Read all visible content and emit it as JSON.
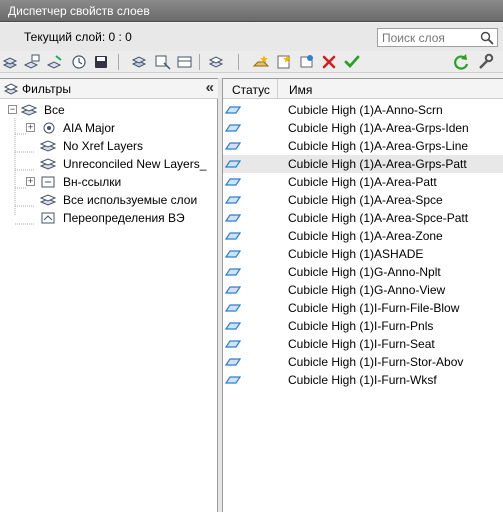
{
  "window": {
    "title": "Диспетчер свойств слоев"
  },
  "current_layer": {
    "label": "Текущий слой: 0 : 0"
  },
  "search": {
    "placeholder": "Поиск слоя"
  },
  "toolbar": {
    "icons": [
      "new-property-filter-icon",
      "new-group-filter-icon",
      "layer-states-manager-icon",
      "save-layer-state-icon",
      "new-layer-icon",
      "new-layer-vp-frozen-icon",
      "delete-layer-icon",
      "set-current-icon",
      "refresh-icon",
      "settings-icon"
    ]
  },
  "filters": {
    "header": "Фильтры",
    "items": [
      {
        "label": "Все"
      },
      {
        "label": "AIA Major"
      },
      {
        "label": "No Xref Layers"
      },
      {
        "label": "Unreconciled New Layers_"
      },
      {
        "label": "Вн-ссылки"
      },
      {
        "label": "Все используемые слои"
      },
      {
        "label": "Переопределения ВЭ"
      }
    ]
  },
  "table": {
    "headers": {
      "status": "Статус",
      "name": "Имя"
    },
    "rows": [
      "Cubicle High (1)A-Anno-Scrn",
      "Cubicle High (1)A-Area-Grps-Iden",
      "Cubicle High (1)A-Area-Grps-Line",
      "Cubicle High (1)A-Area-Grps-Patt",
      "Cubicle High (1)A-Area-Patt",
      "Cubicle High (1)A-Area-Spce",
      "Cubicle High (1)A-Area-Spce-Patt",
      "Cubicle High (1)A-Area-Zone",
      "Cubicle High (1)ASHADE",
      "Cubicle High (1)G-Anno-Nplt",
      "Cubicle High (1)G-Anno-View",
      "Cubicle High (1)I-Furn-File-Blow",
      "Cubicle High (1)I-Furn-Pnls",
      "Cubicle High (1)I-Furn-Seat",
      "Cubicle High (1)I-Furn-Stor-Abov",
      "Cubicle High (1)I-Furn-Wksf"
    ],
    "selected_row": 3
  },
  "colors": {
    "layer_icon": "#2f7fd0",
    "delete": "#d02020",
    "check": "#2aa02a"
  }
}
